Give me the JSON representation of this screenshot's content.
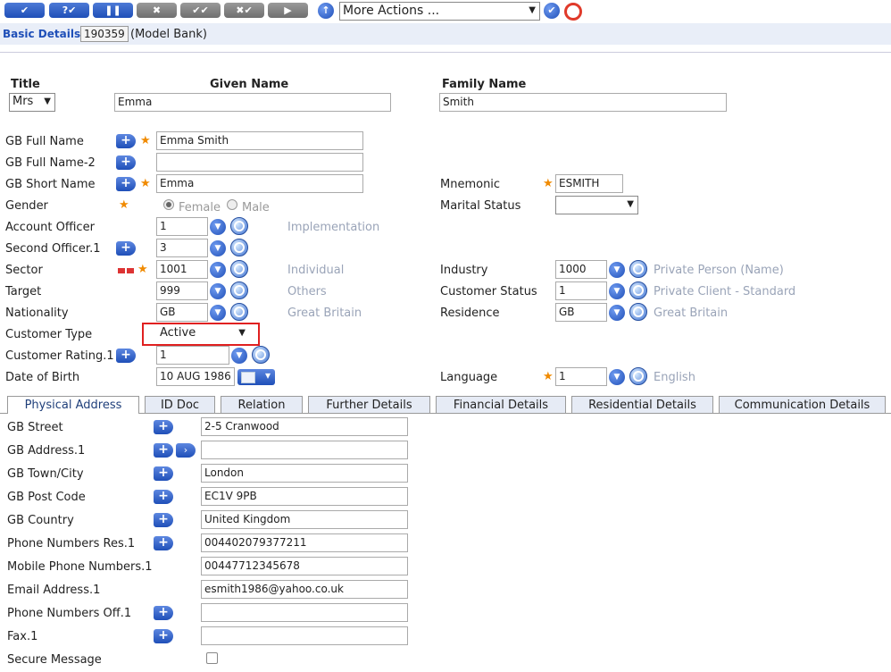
{
  "toolbar": {
    "buttons": [
      "✔",
      "?✔",
      "❚❚",
      "✖",
      "✔✔",
      "✖✔",
      "▶"
    ],
    "upload_icon": "up-arrow-icon",
    "more_actions": "More Actions ...",
    "go_icon": "check-icon",
    "help_icon": "lifebuoy-icon"
  },
  "header": {
    "title": "Basic Details",
    "id": "190359",
    "bank": "(Model Bank)"
  },
  "columns": {
    "title": "Title",
    "given": "Given Name",
    "family": "Family Name"
  },
  "values": {
    "title": "Mrs",
    "given": "Emma",
    "family": "Smith"
  },
  "fields": {
    "gb_full_name": {
      "label": "GB Full Name",
      "value": "Emma Smith"
    },
    "gb_full_name2": {
      "label": "GB Full Name-2",
      "value": ""
    },
    "gb_short_name": {
      "label": "GB Short Name",
      "value": "Emma"
    },
    "gender": {
      "label": "Gender",
      "female": "Female",
      "male": "Male",
      "selected": "Female"
    },
    "account_officer": {
      "label": "Account Officer",
      "value": "1",
      "enrich": "Implementation"
    },
    "second_officer": {
      "label": "Second Officer.1",
      "value": "3"
    },
    "sector": {
      "label": "Sector",
      "value": "1001",
      "enrich": "Individual"
    },
    "target": {
      "label": "Target",
      "value": "999",
      "enrich": "Others"
    },
    "nationality": {
      "label": "Nationality",
      "value": "GB",
      "enrich": "Great Britain"
    },
    "customer_type": {
      "label": "Customer Type",
      "value": "Active"
    },
    "customer_rating": {
      "label": "Customer Rating.1",
      "value": "1"
    },
    "dob": {
      "label": "Date of Birth",
      "value": "10 AUG 1986"
    },
    "mnemonic": {
      "label": "Mnemonic",
      "value": "ESMITH"
    },
    "marital_status": {
      "label": "Marital Status",
      "value": ""
    },
    "industry": {
      "label": "Industry",
      "value": "1000",
      "enrich": "Private Person (Name)"
    },
    "customer_status": {
      "label": "Customer Status",
      "value": "1",
      "enrich": "Private Client - Standard"
    },
    "residence": {
      "label": "Residence",
      "value": "GB",
      "enrich": "Great Britain"
    },
    "language": {
      "label": "Language",
      "value": "1",
      "enrich": "English"
    }
  },
  "tabs": [
    "Physical Address",
    "ID Doc",
    "Relation",
    "Further Details",
    "Financial Details",
    "Residential Details",
    "Communication Details"
  ],
  "address": [
    {
      "label": "GB Street",
      "value": "2-5 Cranwood"
    },
    {
      "label": "GB Address.1",
      "value": ""
    },
    {
      "label": "GB Town/City",
      "value": "London"
    },
    {
      "label": "GB Post Code",
      "value": "EC1V 9PB"
    },
    {
      "label": "GB Country",
      "value": "United Kingdom"
    },
    {
      "label": "Phone Numbers Res.1",
      "value": "004402079377211"
    },
    {
      "label": "Mobile Phone Numbers.1",
      "value": "00447712345678"
    },
    {
      "label": "Email Address.1",
      "value": "esmith1986@yahoo.co.uk"
    },
    {
      "label": "Phone Numbers Off.1",
      "value": ""
    },
    {
      "label": "Fax.1",
      "value": ""
    },
    {
      "label": "Secure Message",
      "value": ""
    }
  ]
}
